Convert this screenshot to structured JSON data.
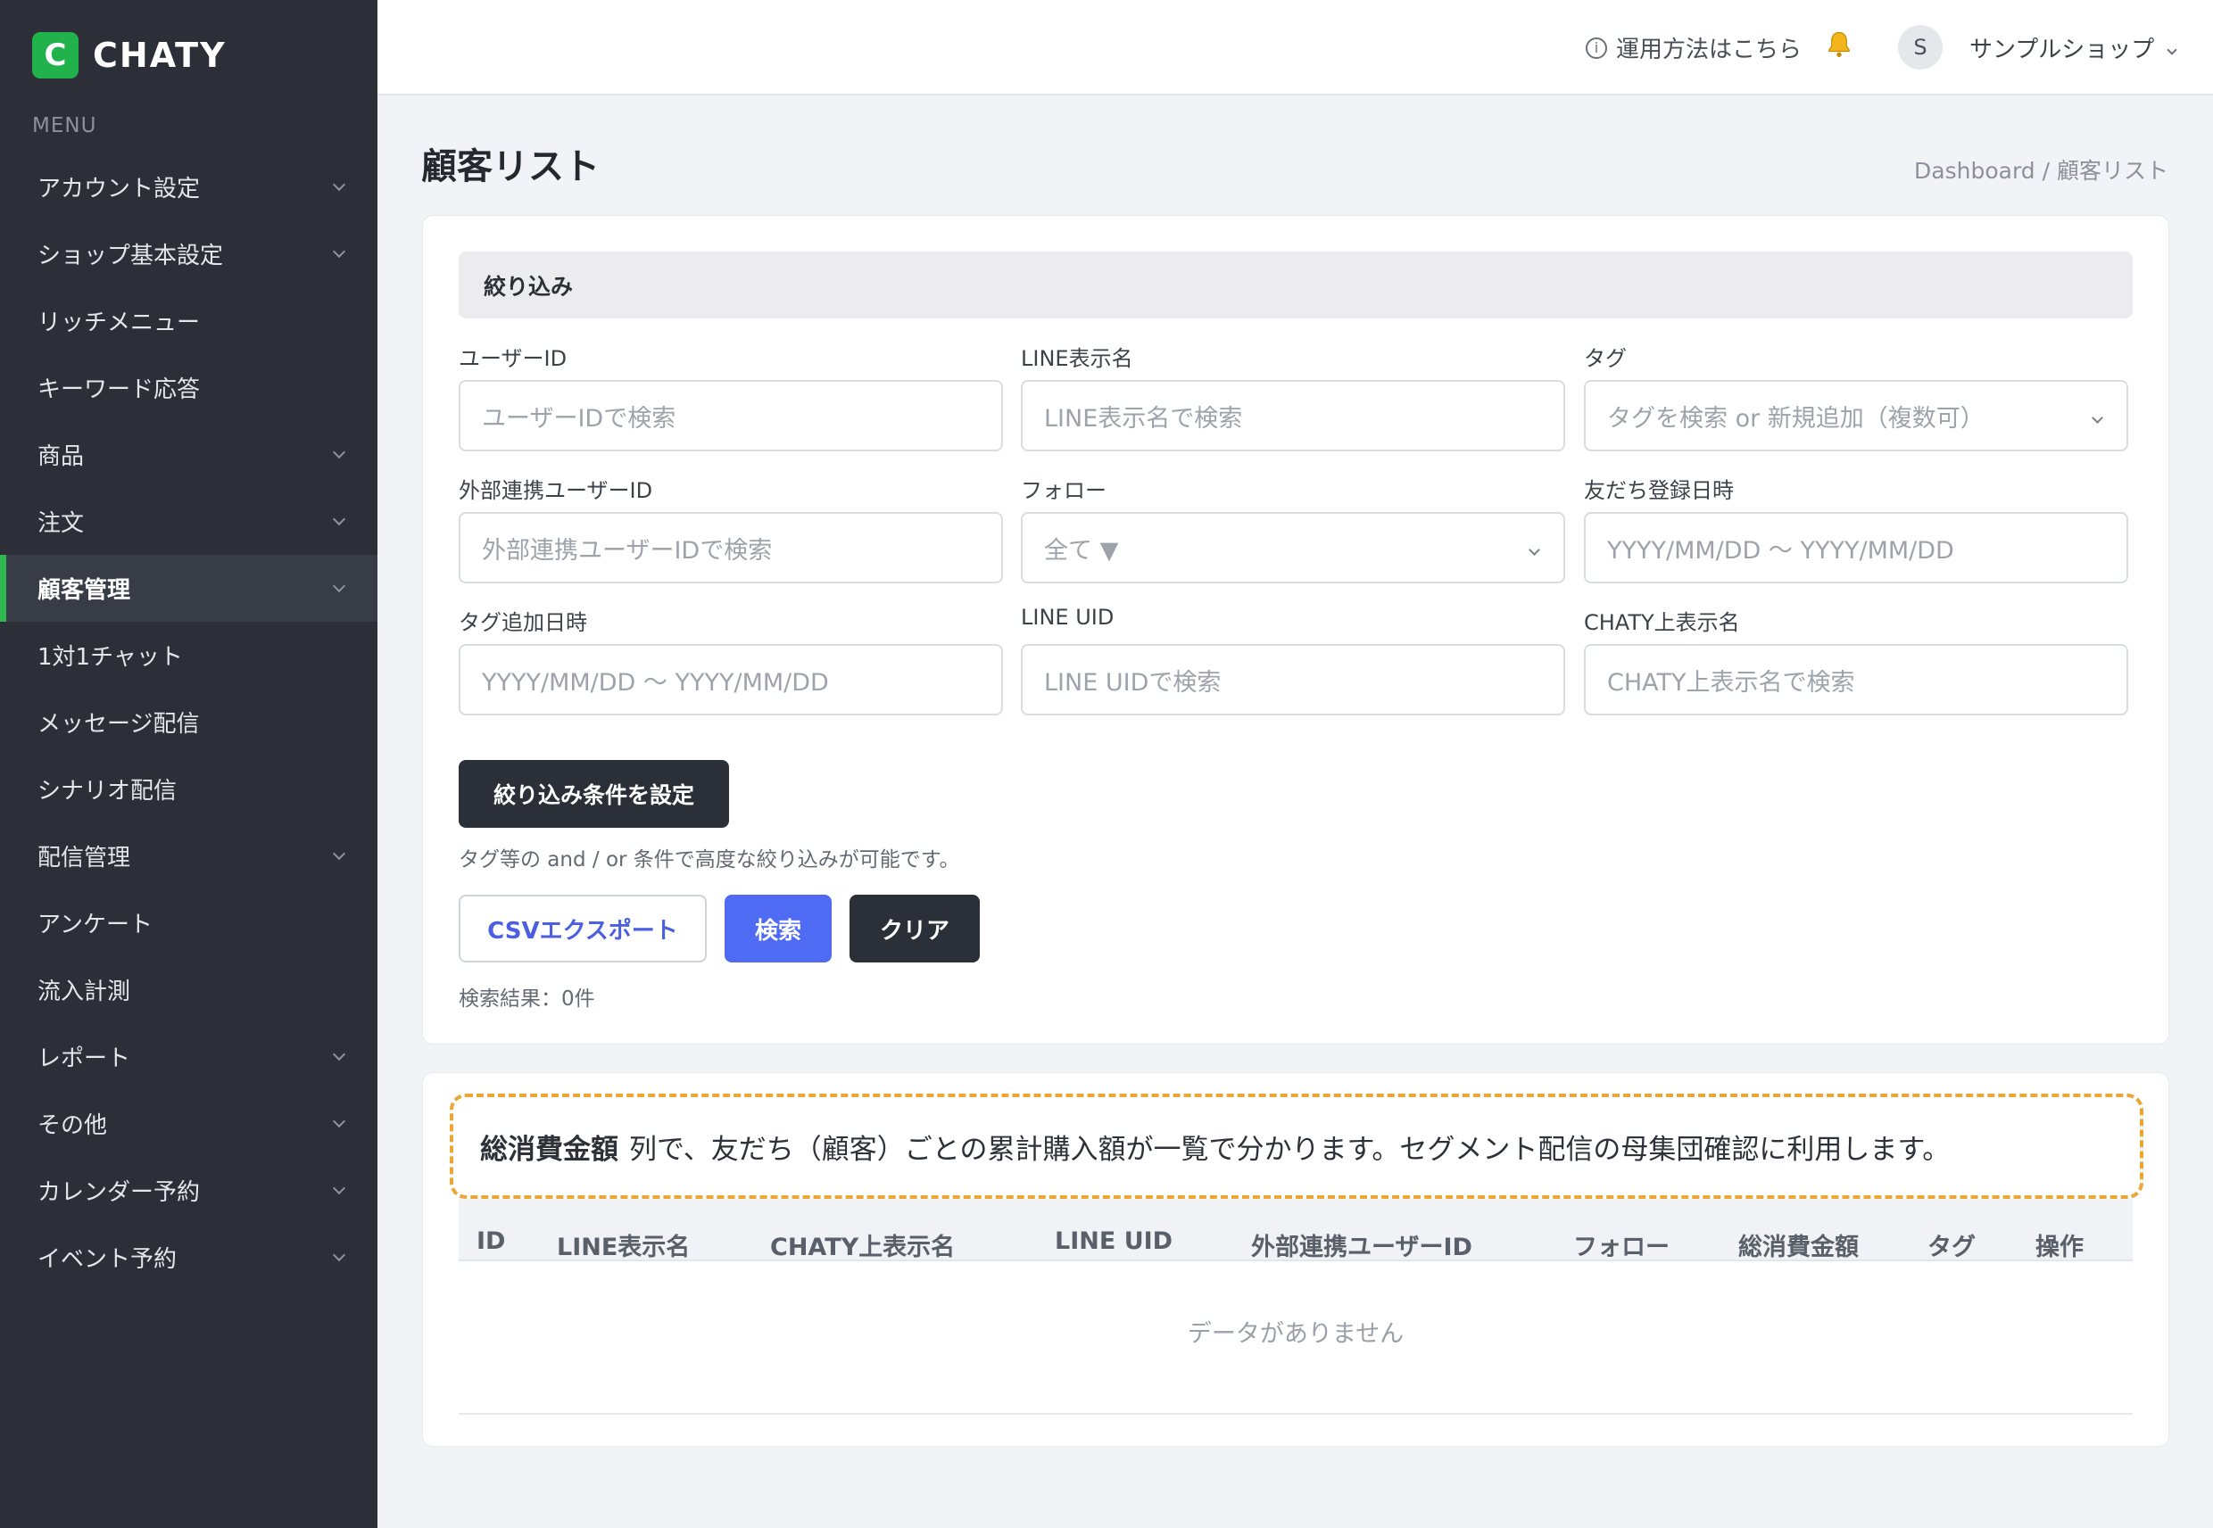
{
  "brand": {
    "logo_letter": "C",
    "name": "CHATY",
    "color": "#22b24c"
  },
  "sidebar": {
    "menu_label": "MENU",
    "items": [
      {
        "label": "アカウント設定",
        "chevron": true
      },
      {
        "label": "ショップ基本設定",
        "chevron": true
      },
      {
        "label": "リッチメニュー",
        "chevron": false
      },
      {
        "label": "キーワード応答",
        "chevron": false
      },
      {
        "label": "商品",
        "chevron": true
      },
      {
        "label": "注文",
        "chevron": true
      },
      {
        "label": "顧客管理",
        "chevron": true,
        "active": true
      },
      {
        "label": "1対1チャット",
        "chevron": false
      },
      {
        "label": "メッセージ配信",
        "chevron": false
      },
      {
        "label": "シナリオ配信",
        "chevron": false
      },
      {
        "label": "配信管理",
        "chevron": true
      },
      {
        "label": "アンケート",
        "chevron": false
      },
      {
        "label": "流入計測",
        "chevron": false
      },
      {
        "label": "レポート",
        "chevron": true
      },
      {
        "label": "その他",
        "chevron": true
      },
      {
        "label": "カレンダー予約",
        "chevron": true
      },
      {
        "label": "イベント予約",
        "chevron": true
      }
    ]
  },
  "topbar": {
    "help_icon": "i",
    "help_label": "運用方法はこちら",
    "avatar_initial": "S",
    "shop_name": "サンプルショップ"
  },
  "page": {
    "title": "顧客リスト",
    "breadcrumb": "Dashboard / 顧客リスト"
  },
  "filter": {
    "header": "絞り込み",
    "fields": [
      {
        "label": "ユーザーID",
        "placeholder": "ユーザーIDで検索",
        "select": false
      },
      {
        "label": "LINE表示名",
        "placeholder": "LINE表示名で検索",
        "select": false
      },
      {
        "label": "タグ",
        "placeholder": "タグを検索 or 新規追加（複数可）",
        "select": true
      },
      {
        "label": "外部連携ユーザーID",
        "placeholder": "外部連携ユーザーIDで検索",
        "select": false
      },
      {
        "label": "フォロー",
        "placeholder": "全て ▼",
        "select": true
      },
      {
        "label": "友だち登録日時",
        "placeholder": "YYYY/MM/DD 〜 YYYY/MM/DD",
        "select": false
      },
      {
        "label": "タグ追加日時",
        "placeholder": "YYYY/MM/DD 〜 YYYY/MM/DD",
        "select": false
      },
      {
        "label": "LINE UID",
        "placeholder": "LINE UIDで検索",
        "select": false
      },
      {
        "label": "CHATY上表示名",
        "placeholder": "CHATY上表示名で検索",
        "select": false
      }
    ],
    "condition_button": "絞り込み条件を設定",
    "condition_note": "タグ等の and / or 条件で高度な絞り込みが可能です。",
    "csv_button": "CSVエクスポート",
    "search_button": "検索",
    "clear_button": "クリア",
    "result_count": "検索結果：0件"
  },
  "callout": {
    "bold": "総消費金額",
    "text": "列で、友だち（顧客）ごとの累計購入額が一覧で分かります。セグメント配信の母集団確認に利用します。",
    "border_color": "#eba634"
  },
  "table": {
    "columns": [
      "ID",
      "LINE表示名",
      "CHATY上表示名",
      "LINE UID",
      "外部連携ユーザーID",
      "フォロー",
      "総消費金額",
      "タグ",
      "操作"
    ],
    "empty": "データがありません"
  }
}
